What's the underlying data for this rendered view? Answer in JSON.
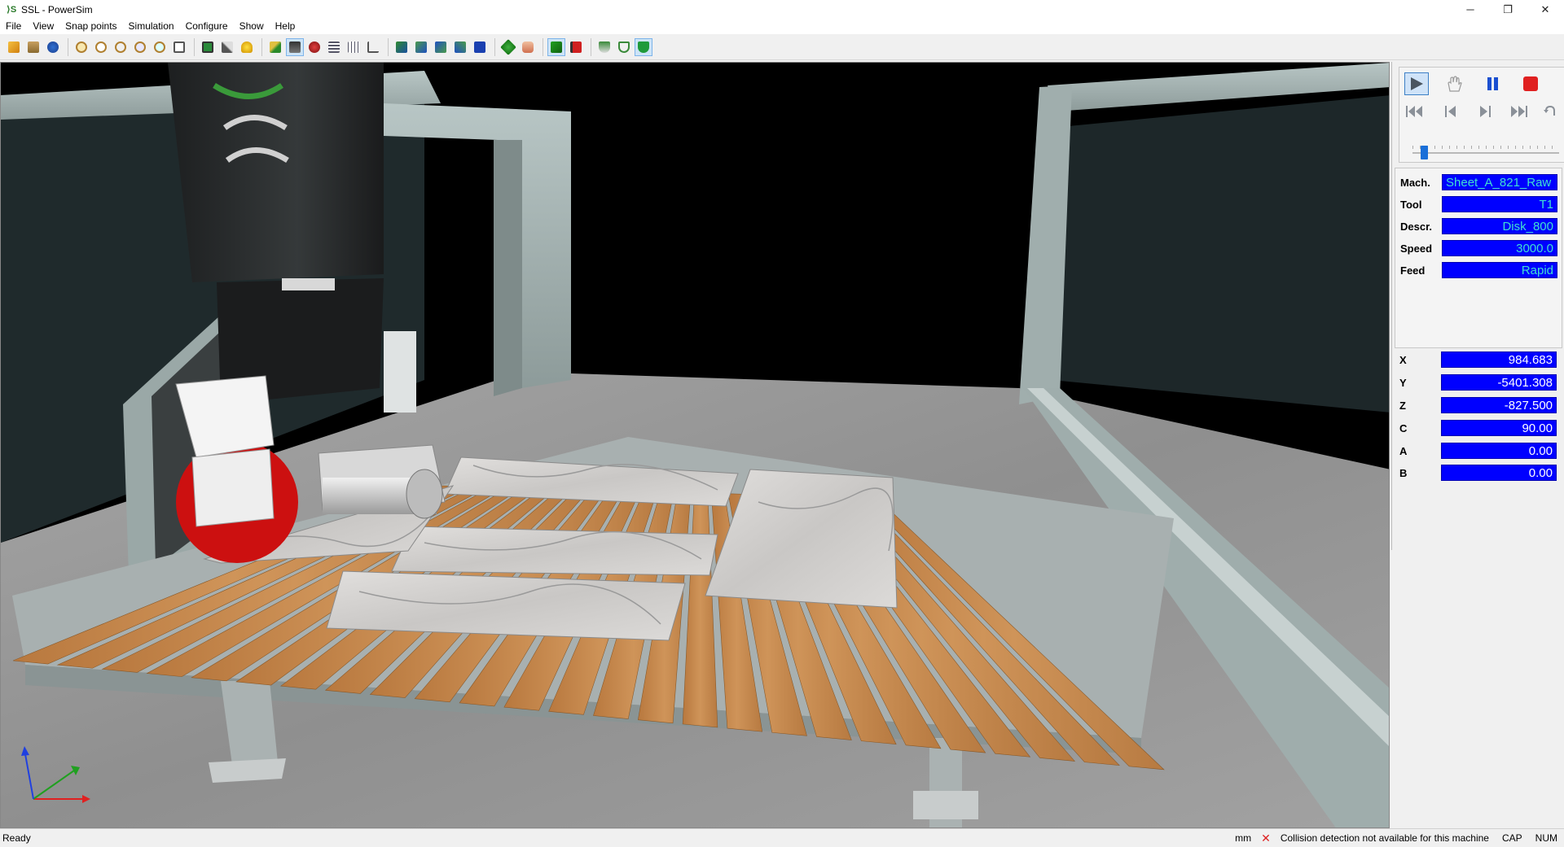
{
  "window": {
    "title": "SSL - PowerSim",
    "icon": "powersim-app-icon",
    "controls": {
      "minimize": "─",
      "restore": "❐",
      "close": "✕"
    }
  },
  "menu": [
    "File",
    "View",
    "Snap points",
    "Simulation",
    "Configure",
    "Show",
    "Help"
  ],
  "toolbar": {
    "groups": [
      [
        "open-icon",
        "print-icon",
        "import-icon"
      ],
      [
        "zoom-in-icon",
        "zoom-window-icon",
        "zoom-out-icon",
        "zoom-fit-icon",
        "zoom-previous-icon",
        "zoom-all-icon"
      ],
      [
        "screen-icon",
        "measure-icon",
        "light-icon"
      ],
      [
        "pencil-icon",
        "select-icon",
        "gear-icon",
        "list-icon",
        "table-icon",
        "axes-icon"
      ],
      [
        "view-iso-icon",
        "view-front-icon",
        "view-left-icon",
        "view-right-icon",
        "view-top-icon"
      ],
      [
        "move-icon",
        "hand-icon"
      ],
      [
        "check-icon",
        "flag-icon"
      ],
      [
        "shield-icon",
        "shield-outline-icon",
        "shield-green-icon"
      ]
    ],
    "active": [
      "select-icon",
      "check-icon",
      "shield-green-icon"
    ]
  },
  "sim_controls": {
    "buttons": [
      "play-icon",
      "hand-icon",
      "pause-icon",
      "stop-icon",
      "rewind-start-icon",
      "step-back-icon",
      "step-forward-icon",
      "fast-forward-end-icon",
      "undo-icon"
    ],
    "active": "play-icon",
    "speed_slider": 0.08,
    "colors": {
      "stop": "#e02020",
      "pause": "#1a4fd0"
    }
  },
  "machine_info": [
    {
      "label": "Mach.",
      "value": "Sheet_A_821_Raw"
    },
    {
      "label": "Tool",
      "value": "T1"
    },
    {
      "label": "Descr.",
      "value": "Disk_800"
    },
    {
      "label": "Speed",
      "value": "3000.0"
    },
    {
      "label": "Feed",
      "value": "Rapid"
    }
  ],
  "coordinates": [
    {
      "label": "X",
      "value": "984.683"
    },
    {
      "label": "Y",
      "value": "-5401.308"
    },
    {
      "label": "Z",
      "value": "-827.500"
    },
    {
      "label": "C",
      "value": "90.00"
    },
    {
      "label": "A",
      "value": "0.00"
    },
    {
      "label": "B",
      "value": "0.00"
    }
  ],
  "status": {
    "left": "Ready",
    "units": "mm",
    "collision_icon": "collision-x-icon",
    "collision_text": "Collision detection not available for this machine",
    "caps": "CAP",
    "num": "NUM"
  },
  "scene": {
    "description_colors": {
      "floor": "#9a9a9a",
      "frame": "#a9b7b6",
      "wood": "#c58a4f",
      "marble": "#d4d2d0",
      "blade": "#cc1010",
      "head": "#2b2d2e"
    },
    "axis_colors": {
      "x": "#e02020",
      "y": "#20a020",
      "z": "#2040e0"
    }
  }
}
